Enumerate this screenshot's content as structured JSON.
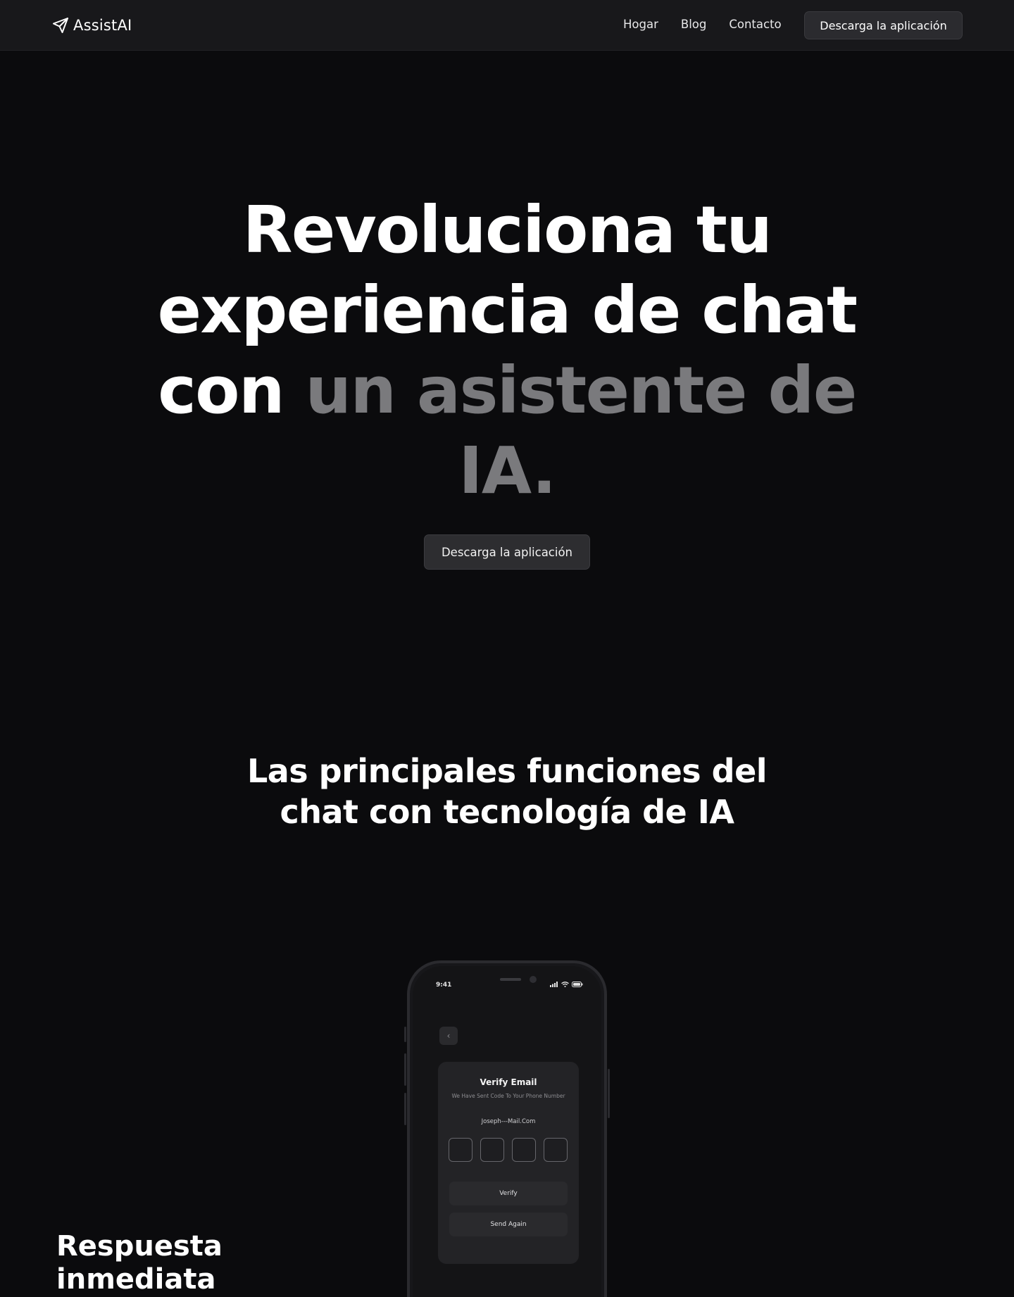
{
  "nav": {
    "brand": "AssistAI",
    "links": [
      "Hogar",
      "Blog",
      "Contacto"
    ],
    "cta": "Descarga la aplicación"
  },
  "hero": {
    "title_main": "Revoluciona tu experiencia de chat con ",
    "title_muted": "un asistente de IA.",
    "cta": "Descarga la aplicación"
  },
  "features": {
    "title": "Las principales funciones del chat con tecnología de IA",
    "first_feature": "Respuesta inmediata"
  },
  "phone": {
    "time": "9:41",
    "card_title": "Verify Email",
    "card_subtitle": "We Have Sent Code To Your Phone Number",
    "email": "Joseph---Mail.Com",
    "verify_button": "Verify",
    "send_again_button": "Send Again"
  },
  "colors": {
    "background": "#0b0b0d",
    "nav_background": "#18181b",
    "muted_text": "#7a7a7d",
    "button_background": "#2d2d30"
  }
}
